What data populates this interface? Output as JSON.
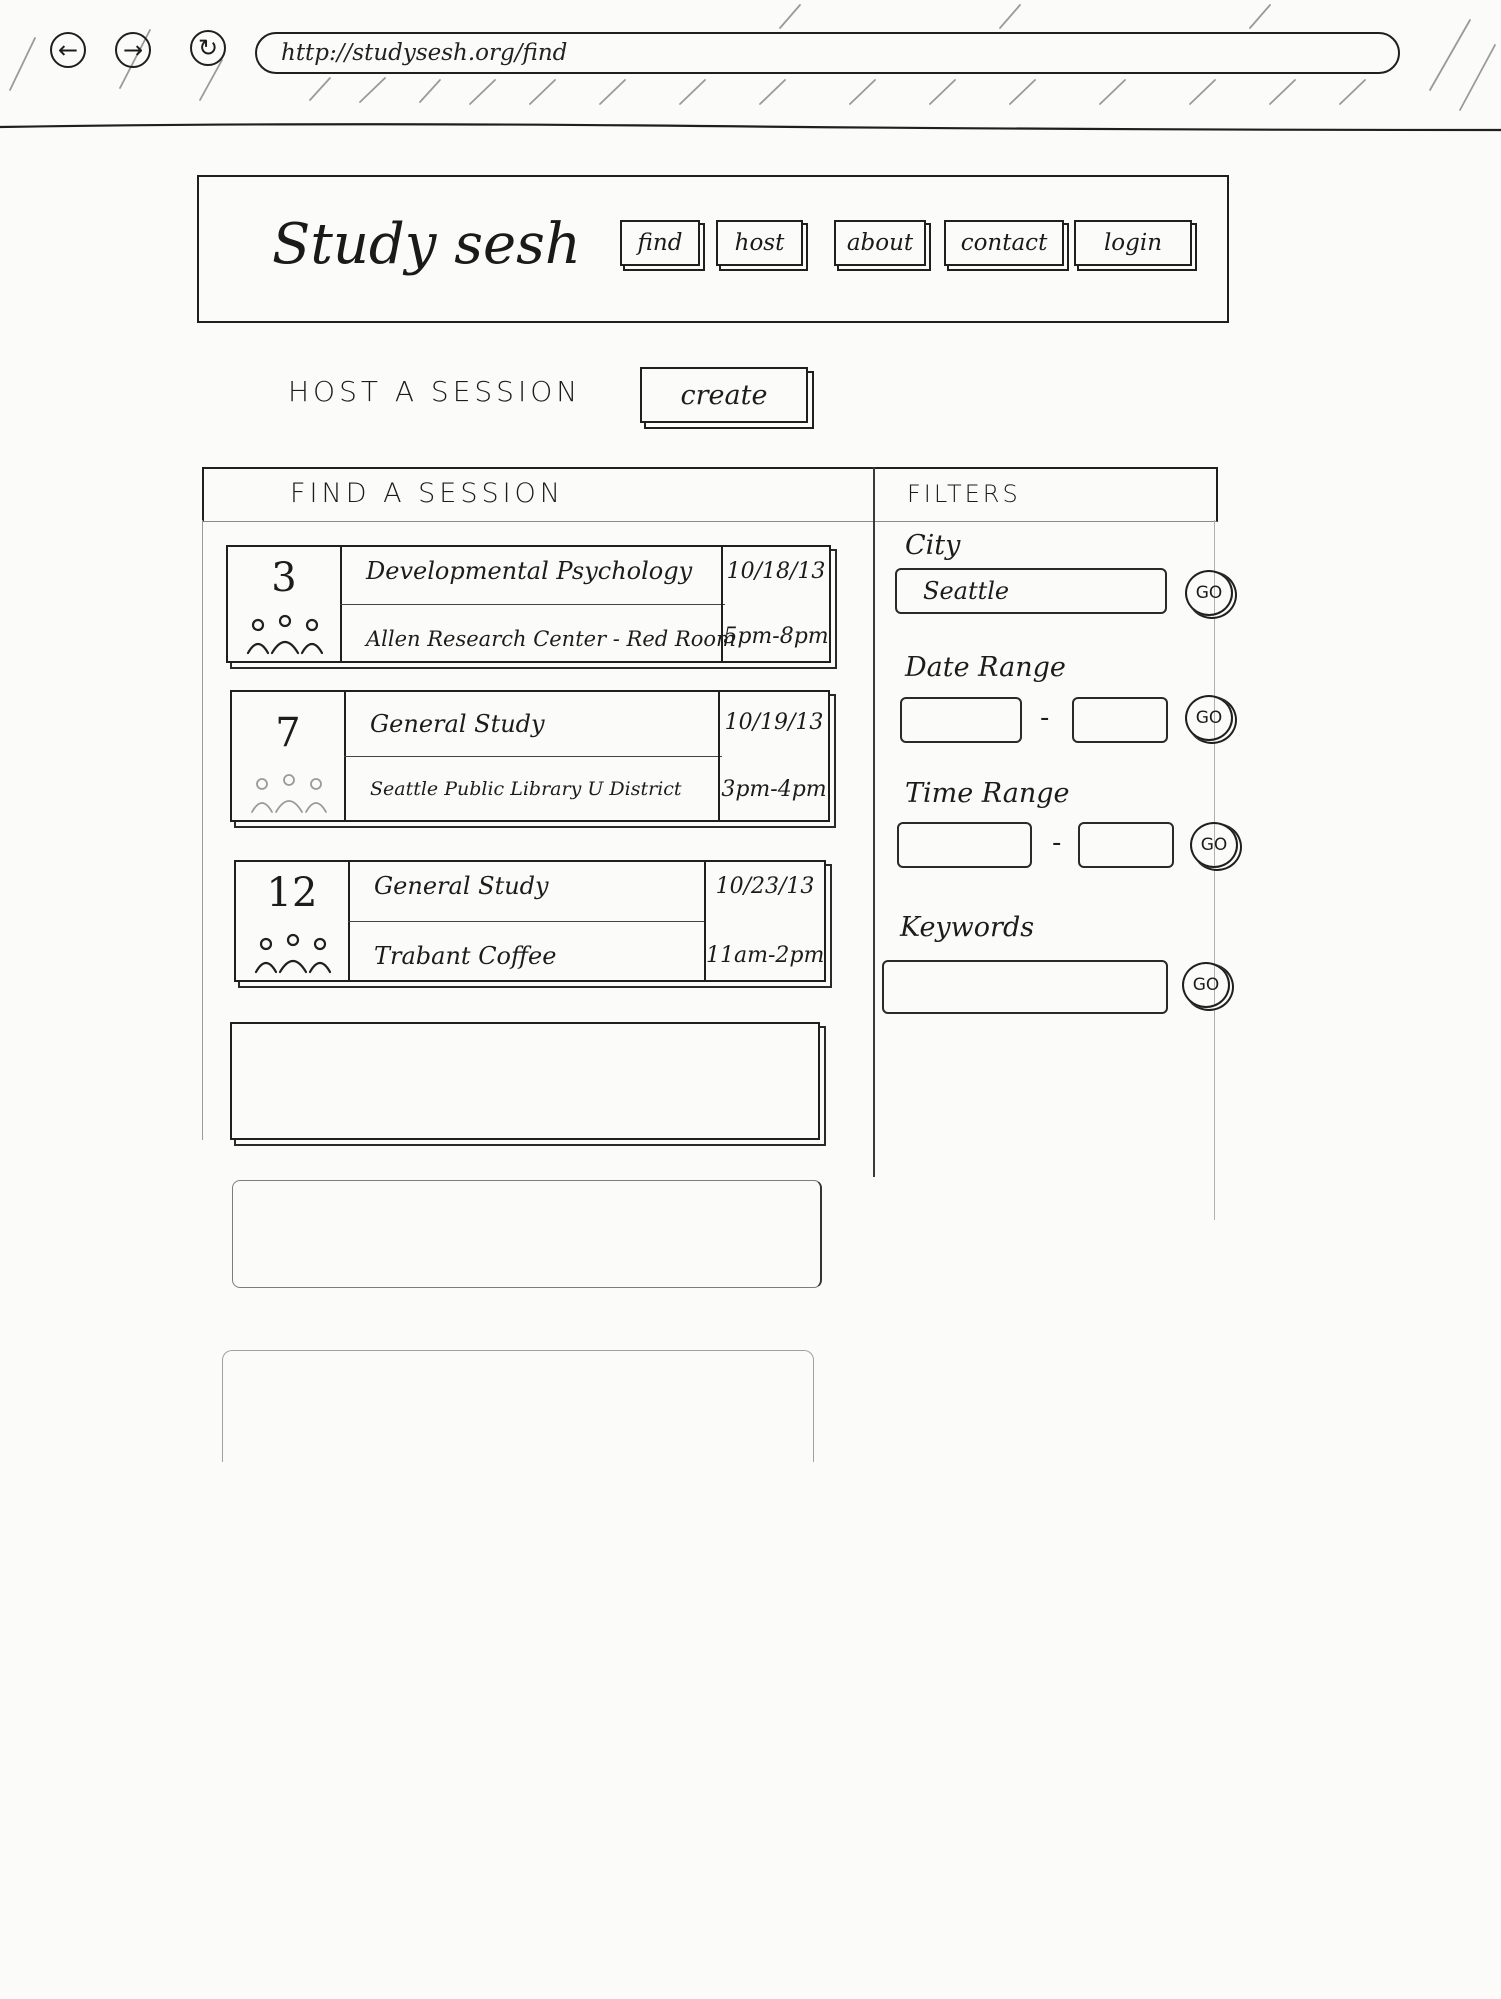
{
  "browser": {
    "url": "http://studysesh.org/find",
    "back_icon": "←",
    "forward_icon": "→",
    "refresh_icon": "↻"
  },
  "header": {
    "title": "Study sesh",
    "nav": [
      "find",
      "host",
      "about",
      "contact",
      "login"
    ]
  },
  "host": {
    "label": "HOST A SESSION",
    "button": "create"
  },
  "find": {
    "heading": "FIND A SESSION",
    "sessions": [
      {
        "count": "3",
        "title": "Developmental Psychology",
        "location": "Allen Research Center - Red Room",
        "date": "10/18/13",
        "time": "5pm-8pm"
      },
      {
        "count": "7",
        "title": "General Study",
        "location": "Seattle Public Library U District",
        "date": "10/19/13",
        "time": "3pm-4pm"
      },
      {
        "count": "12",
        "title": "General Study",
        "location": "Trabant Coffee",
        "date": "10/23/13",
        "time": "11am-2pm"
      }
    ]
  },
  "filters": {
    "heading": "FILTERS",
    "city_label": "City",
    "city_value": "Seattle",
    "date_label": "Date Range",
    "time_label": "Time Range",
    "keywords_label": "Keywords",
    "range_separator": "-",
    "go": "GO"
  }
}
